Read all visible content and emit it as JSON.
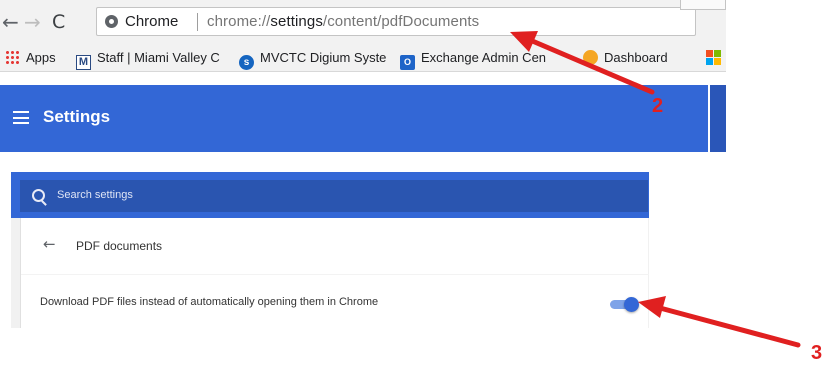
{
  "browser": {
    "nav": {
      "back": "←",
      "forward": "→",
      "reload": "C"
    },
    "omnibox": {
      "chip_label": "Chrome",
      "url_prefix": "chrome://",
      "url_host": "settings",
      "url_path": "/content/pdfDocuments"
    },
    "bookmarks": {
      "apps": "Apps",
      "staff": "Staff | Miami Valley C",
      "mvctc": "MVCTC Digium Syste",
      "exchange": "Exchange Admin Cen",
      "dashboard": "Dashboard"
    },
    "settings_header": {
      "title": "Settings"
    }
  },
  "settings_page": {
    "search_placeholder": "Search settings",
    "page_title": "PDF documents",
    "option_label": "Download PDF files instead of automatically opening them in Chrome",
    "toggle_on": true,
    "accent_color": "#3367d6"
  },
  "annotations": {
    "step_2": "2",
    "step_3": "3",
    "arrow_color": "#e02020"
  }
}
